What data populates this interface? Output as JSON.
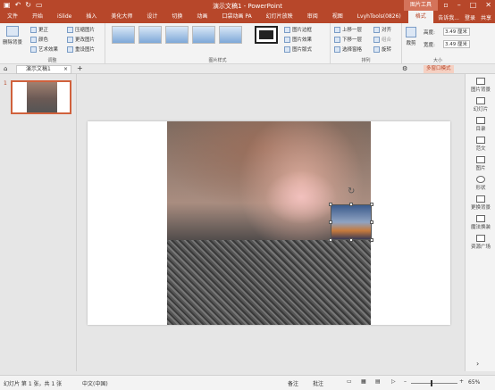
{
  "titlebar": {
    "title": "演示文稿1 - PowerPoint",
    "tool_context": "图片工具"
  },
  "tabs": [
    "文件",
    "开始",
    "iSlide",
    "插入",
    "美化大师",
    "设计",
    "切换",
    "动画",
    "口袋动画 PA",
    "幻灯片放映",
    "审阅",
    "视图",
    "LvyhTools(0826)",
    "格式"
  ],
  "tabs_right": {
    "tell": "告诉我...",
    "login": "登录",
    "share": "共享"
  },
  "ribbon": {
    "adjust": {
      "remove_bg": "删除背景",
      "corrections": "更正",
      "color": "颜色",
      "artistic": "艺术效果",
      "compress": "压缩图片",
      "change": "更改图片",
      "reset": "重设图片",
      "name": "调整"
    },
    "styles": {
      "name": "图片样式",
      "border": "图片边框",
      "effects": "图片效果",
      "layout": "图片版式"
    },
    "arrange": {
      "forward": "上移一层",
      "backward": "下移一层",
      "selection_pane": "选择窗格",
      "align": "对齐",
      "group": "组合",
      "rotate": "旋转",
      "name": "排列"
    },
    "size": {
      "crop": "裁剪",
      "height_label": "高度:",
      "height_value": "3.49 厘米",
      "width_label": "宽度:",
      "width_value": "3.49 厘米",
      "name": "大小"
    }
  },
  "doc_tab": "演示文稿1",
  "multi_window": "多窗口模式",
  "slide_number": "1",
  "right_pane": [
    "图片背景",
    "幻灯片",
    "目录",
    "范文",
    "图片",
    "形状",
    "更换背景",
    "魔法换装",
    "资源广场"
  ],
  "status": {
    "slide_info": "幻灯片 第 1 张，共 1 张",
    "language": "中文(中国)",
    "notes": "备注",
    "comments": "批注",
    "zoom": "65%"
  }
}
